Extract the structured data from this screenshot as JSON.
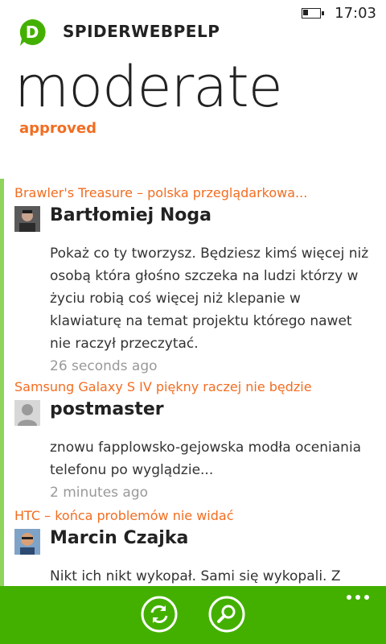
{
  "status": {
    "time": "17:03"
  },
  "app": {
    "name": "SPIDERWEBPELP",
    "logo_letter": "D"
  },
  "page": {
    "title": "moderate",
    "pivot": "approved"
  },
  "comments": [
    {
      "topic": "Brawler's Treasure – polska przeglądarkowa...",
      "author": "Bartłomiej Noga",
      "body": "Pokaż co ty tworzysz. Będziesz kimś więcej niż osobą która głośno szczeka na ludzi którzy w życiu robią coś więcej niż klepanie w klawiaturę na temat projektu którego nawet nie raczył przeczytać.",
      "time": "26 seconds ago",
      "avatar": "photo-avatar"
    },
    {
      "topic": "Samsung Galaxy S IV piękny raczej nie będzie",
      "author": "postmaster",
      "body": "znowu fapplowsko-gejowska modła oceniania telefonu po wyglądzie...",
      "time": "2 minutes ago",
      "avatar": "default-avatar"
    },
    {
      "topic": "HTC – końca problemów nie widać",
      "author": "Marcin Czajka",
      "body": "Nikt ich nikt wykopał. Sami się wykopali. Z punktu Androidowca... wiem co się dzieje",
      "time": "",
      "avatar": "photo-avatar"
    }
  ],
  "appbar": {
    "buttons": [
      "refresh-icon",
      "search-icon"
    ],
    "more": "more-icon"
  },
  "colors": {
    "accent": "#f26d21",
    "appbar": "#43b000",
    "logo": "#43b000",
    "list_bar": "#8fd45c"
  }
}
